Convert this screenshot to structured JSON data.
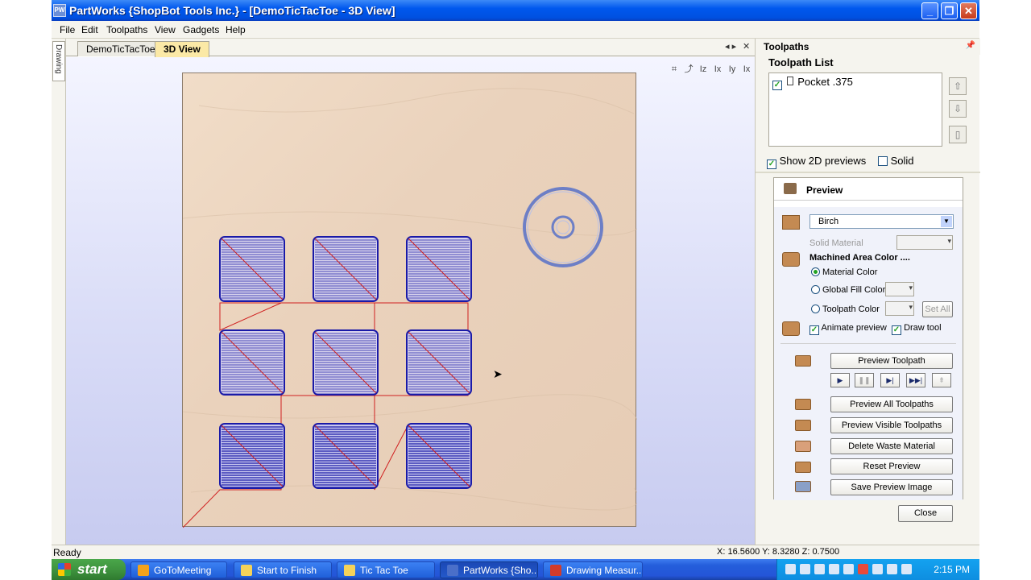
{
  "window": {
    "title": "PartWorks {ShopBot Tools Inc.} - [DemoTicTacToe - 3D View]",
    "app_icon": "PW",
    "minimize_label": "_",
    "restore_label": "❐",
    "close_label": "✕"
  },
  "menu": [
    "File",
    "Edit",
    "Toolpaths",
    "View",
    "Gadgets",
    "Help"
  ],
  "left_tab": "Drawing",
  "doc_tabs": [
    {
      "label": "DemoTicTacToe",
      "active": false
    },
    {
      "label": "3D View",
      "active": true
    }
  ],
  "doc_tab_controls": {
    "arrows": "◂ ▸",
    "close": "✕"
  },
  "viewport_tools": [
    "⌗",
    "⤴",
    "Iz",
    "Ix",
    "Iy",
    "Ix"
  ],
  "toolpaths_panel": {
    "header": "Toolpaths",
    "pin": "📌",
    "list_title": "Toolpath List",
    "items": [
      {
        "label": "Pocket .375",
        "checked": true
      }
    ],
    "show_2d_previews": {
      "label": "Show 2D previews",
      "checked": true
    },
    "solid": {
      "label": "Solid",
      "checked": false
    },
    "side_buttons": [
      "⇧",
      "⇩",
      "▯"
    ]
  },
  "preview": {
    "title": "Preview",
    "material": "Birch",
    "solid_material_label": "Solid Material",
    "machined_area_label": "Machined Area Color ....",
    "options": [
      {
        "label": "Material Color",
        "selected": true
      },
      {
        "label": "Global Fill Color",
        "selected": false
      },
      {
        "label": "Toolpath Color",
        "selected": false
      }
    ],
    "set_all_label": "Set All",
    "animate_preview": {
      "label": "Animate preview",
      "checked": true
    },
    "draw_tool": {
      "label": "Draw tool",
      "checked": true
    },
    "preview_toolpath_label": "Preview Toolpath",
    "playback": [
      "▶",
      "❚❚",
      "▶|",
      "▶▶|",
      "⇞"
    ],
    "buttons": [
      "Preview All Toolpaths",
      "Preview Visible Toolpaths",
      "Delete Waste Material",
      "Reset Preview",
      "Save Preview Image"
    ],
    "close_label": "Close"
  },
  "status": {
    "left": "Ready",
    "coords": "X: 16.5600 Y:  8.3280 Z:  0.7500"
  },
  "taskbar": {
    "start_label": "start",
    "tasks": [
      {
        "label": "GoToMeeting",
        "active": false,
        "icon_color": "#f3a21b"
      },
      {
        "label": "Start to Finish",
        "active": false,
        "icon_color": "#f4d25a"
      },
      {
        "label": "Tic Tac Toe",
        "active": false,
        "icon_color": "#f4d25a"
      },
      {
        "label": "PartWorks {Sho...",
        "active": true,
        "icon_color": "#4a6fc9"
      },
      {
        "label": "Drawing Measur...",
        "active": false,
        "icon_color": "#d13b2b"
      }
    ],
    "clock": "2:15 PM"
  },
  "colors": {
    "toolpath_blue": "#1a1aa8",
    "rapid_red": "#d02020",
    "board": "#ead2bc"
  }
}
